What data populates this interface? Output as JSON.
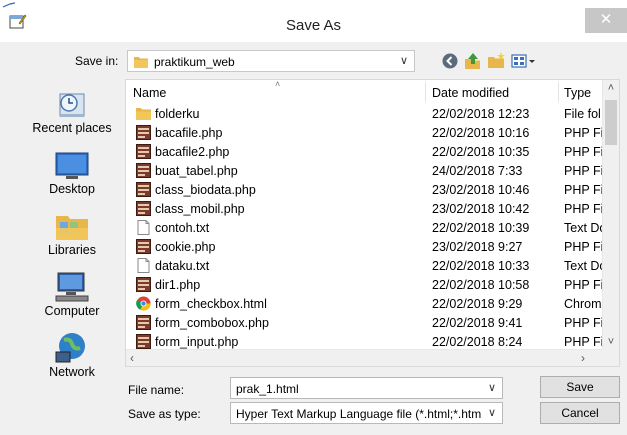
{
  "dialog": {
    "title": "Save As",
    "close_glyph": "✕"
  },
  "save_in": {
    "label": "Save in:",
    "value": "praktikum_web"
  },
  "toolbar": {
    "icons": [
      "back-icon",
      "up-folder-icon",
      "new-folder-icon",
      "views-menu-icon"
    ]
  },
  "places": [
    {
      "label": "Recent places",
      "icon": "recent-places-icon"
    },
    {
      "label": "Desktop",
      "icon": "desktop-icon"
    },
    {
      "label": "Libraries",
      "icon": "libraries-icon"
    },
    {
      "label": "Computer",
      "icon": "computer-icon"
    },
    {
      "label": "Network",
      "icon": "network-icon"
    }
  ],
  "columns": {
    "name": "Name",
    "date": "Date modified",
    "type": "Type"
  },
  "files": [
    {
      "name": "folderku",
      "date": "22/02/2018 12:23",
      "type": "File fol",
      "icon": "folder-icon"
    },
    {
      "name": "bacafile.php",
      "date": "22/02/2018 10:16",
      "type": "PHP Fi",
      "icon": "php-file-icon"
    },
    {
      "name": "bacafile2.php",
      "date": "22/02/2018 10:35",
      "type": "PHP Fi",
      "icon": "php-file-icon"
    },
    {
      "name": "buat_tabel.php",
      "date": "24/02/2018 7:33",
      "type": "PHP Fi",
      "icon": "php-file-icon"
    },
    {
      "name": "class_biodata.php",
      "date": "23/02/2018 10:46",
      "type": "PHP Fi",
      "icon": "php-file-icon"
    },
    {
      "name": "class_mobil.php",
      "date": "23/02/2018 10:42",
      "type": "PHP Fi",
      "icon": "php-file-icon"
    },
    {
      "name": "contoh.txt",
      "date": "22/02/2018 10:39",
      "type": "Text Do",
      "icon": "text-file-icon"
    },
    {
      "name": "cookie.php",
      "date": "23/02/2018 9:27",
      "type": "PHP Fi",
      "icon": "php-file-icon"
    },
    {
      "name": "dataku.txt",
      "date": "22/02/2018 10:33",
      "type": "Text Do",
      "icon": "text-file-icon"
    },
    {
      "name": "dir1.php",
      "date": "22/02/2018 10:58",
      "type": "PHP Fi",
      "icon": "php-file-icon"
    },
    {
      "name": "form_checkbox.html",
      "date": "22/02/2018 9:29",
      "type": "Chrom",
      "icon": "chrome-html-icon"
    },
    {
      "name": "form_combobox.php",
      "date": "22/02/2018 9:41",
      "type": "PHP Fi",
      "icon": "php-file-icon"
    },
    {
      "name": "form_input.php",
      "date": "22/02/2018 8:24",
      "type": "PHP Fi",
      "icon": "php-file-icon"
    }
  ],
  "file_name": {
    "label": "File name:",
    "value": "prak_1.html"
  },
  "save_as_type": {
    "label": "Save as type:",
    "value": "Hyper Text Markup Language file (*.html;*.htm;*"
  },
  "buttons": {
    "save": "Save",
    "cancel": "Cancel"
  },
  "colors": {
    "folder": "#e8b64a",
    "php_icon": "#7a3b2e",
    "chrome_red": "#db4437"
  }
}
